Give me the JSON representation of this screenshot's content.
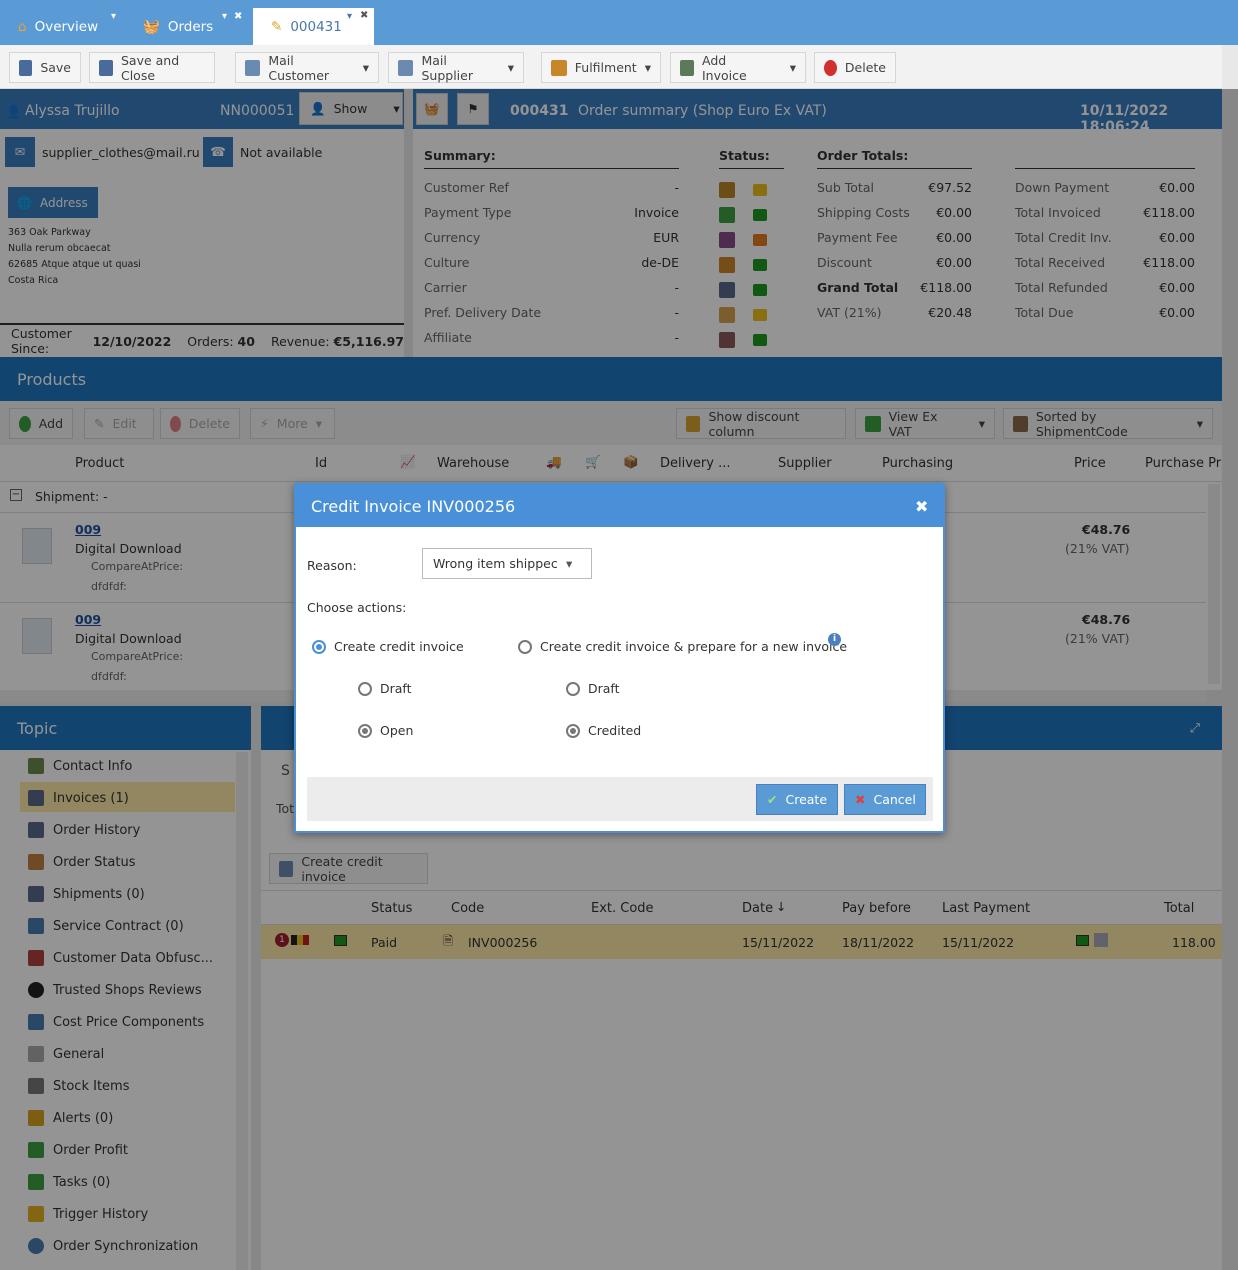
{
  "tabs": [
    {
      "label": "Overview"
    },
    {
      "label": "Orders"
    },
    {
      "label": "000431"
    }
  ],
  "toolbar": {
    "save": "Save",
    "save_close": "Save and Close",
    "mail_customer": "Mail Customer",
    "mail_supplier": "Mail Supplier",
    "fulfilment": "Fulfilment",
    "add_invoice": "Add Invoice",
    "delete": "Delete"
  },
  "customer": {
    "name": "Alyssa Trujillo",
    "number": "NN000051",
    "show": "Show",
    "email": "supplier_clothes@mail.ru",
    "phone": "Not available",
    "address_btn": "Address",
    "address_lines": [
      "363 Oak Parkway",
      "Nulla rerum obcaecat",
      "62685 Atque atque ut quasi",
      "Costa Rica"
    ],
    "since_label": "Customer Since:",
    "since": "12/10/2022",
    "orders_label": "Orders:",
    "orders": "40",
    "revenue_label": "Revenue:",
    "revenue": "€5,116.97"
  },
  "order": {
    "number": "000431",
    "title": "Order summary (Shop Euro Ex VAT)",
    "datetime": "10/11/2022 18:06:24"
  },
  "summary": {
    "heading": "Summary:",
    "rows": [
      {
        "label": "Customer Ref",
        "value": "-"
      },
      {
        "label": "Payment Type",
        "value": "Invoice"
      },
      {
        "label": "Currency",
        "value": "EUR"
      },
      {
        "label": "Culture",
        "value": "de-DE"
      },
      {
        "label": "Carrier",
        "value": "-"
      },
      {
        "label": "Pref. Delivery Date",
        "value": "-"
      },
      {
        "label": "Affiliate",
        "value": "-"
      }
    ]
  },
  "status": {
    "heading": "Status:"
  },
  "totals": {
    "heading": "Order Totals:",
    "left": [
      {
        "label": "Sub Total",
        "value": "€97.52"
      },
      {
        "label": "Shipping Costs",
        "value": "€0.00"
      },
      {
        "label": "Payment Fee",
        "value": "€0.00"
      },
      {
        "label": "Discount",
        "value": "€0.00"
      },
      {
        "label": "Grand Total",
        "value": "€118.00"
      },
      {
        "label": "VAT (21%)",
        "value": "€20.48"
      }
    ],
    "right": [
      {
        "label": "Down Payment",
        "value": "€0.00"
      },
      {
        "label": "Total Invoiced",
        "value": "€118.00"
      },
      {
        "label": "Total Credit Inv.",
        "value": "€0.00"
      },
      {
        "label": "Total Received",
        "value": "€118.00"
      },
      {
        "label": "Total Refunded",
        "value": "€0.00"
      },
      {
        "label": "Total Due",
        "value": "€0.00"
      }
    ]
  },
  "products": {
    "heading": "Products",
    "add": "Add",
    "edit": "Edit",
    "delete": "Delete",
    "more": "More",
    "show_discount": "Show discount column",
    "view_ex_vat": "View Ex VAT",
    "sorted": "Sorted by ShipmentCode",
    "columns": {
      "product": "Product",
      "id": "Id",
      "warehouse": "Warehouse",
      "delivery": "Delivery ...",
      "supplier": "Supplier",
      "purchasing": "Purchasing",
      "price": "Price",
      "purchase_price": "Purchase Pri"
    },
    "shipment": "Shipment: -",
    "rows": [
      {
        "code": "009",
        "name": "Digital Download",
        "attr1": "CompareAtPrice:",
        "attr2": "dfdfdf:",
        "price": "€48.76",
        "vat": "(21% VAT)"
      },
      {
        "code": "009",
        "name": "Digital Download",
        "attr1": "CompareAtPrice:",
        "attr2": "dfdfdf:",
        "price": "€48.76",
        "vat": "(21% VAT)"
      }
    ]
  },
  "topic": {
    "heading": "Topic",
    "items": [
      "Contact Info",
      "Invoices (1)",
      "Order History",
      "Order Status",
      "Shipments (0)",
      "Service Contract (0)",
      "Customer Data Obfusc...",
      "Trusted Shops Reviews",
      "Cost Price Components",
      "General",
      "Stock Items",
      "Alerts (0)",
      "Order Profit",
      "Tasks (0)",
      "Trigger History",
      "Order Synchronization"
    ]
  },
  "invoices": {
    "create_credit": "Create credit invoice",
    "columns": {
      "status": "Status",
      "code": "Code",
      "ext": "Ext. Code",
      "date": "Date",
      "pay_before": "Pay before",
      "last_payment": "Last Payment",
      "total": "Total"
    },
    "row": {
      "badge": "1",
      "status": "Paid",
      "code": "INV000256",
      "date": "15/11/2022",
      "pay_before": "18/11/2022",
      "last_payment": "15/11/2022",
      "total": "118.00"
    },
    "partial_s": "S",
    "partial_tot": "Tot"
  },
  "dialog": {
    "title": "Credit Invoice INV000256",
    "reason_label": "Reason:",
    "reason_value": "Wrong item shippec",
    "choose": "Choose actions:",
    "opt1": "Create credit invoice",
    "opt2": "Create credit invoice & prepare for a new invoice",
    "draft1": "Draft",
    "open": "Open",
    "draft2": "Draft",
    "credited": "Credited",
    "create": "Create",
    "cancel": "Cancel"
  }
}
